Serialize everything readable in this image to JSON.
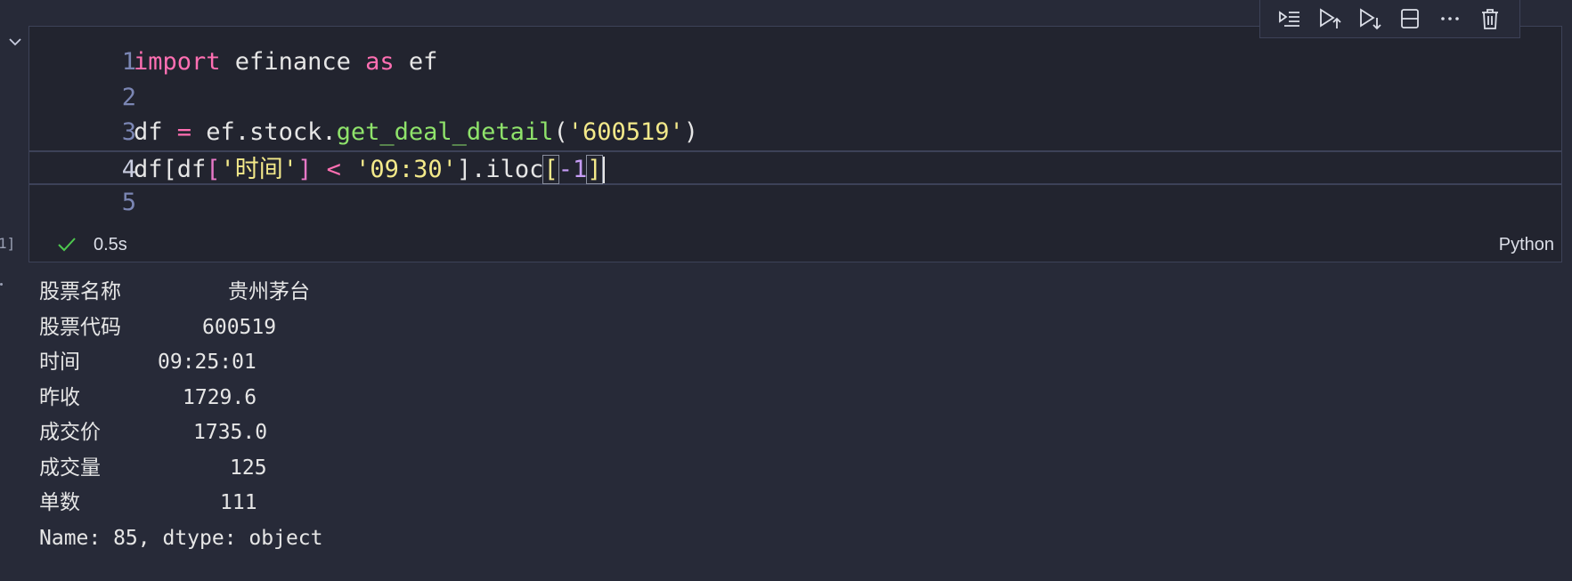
{
  "cell": {
    "execution_label": "1]",
    "code_lines": [
      {
        "num": "1"
      },
      {
        "num": "2"
      },
      {
        "num": "3"
      },
      {
        "num": "4"
      },
      {
        "num": "5"
      }
    ],
    "tokens": {
      "l1_import": "import",
      "l1_mod": " efinance ",
      "l1_as": "as",
      "l1_alias": " ef",
      "l3_df": "df ",
      "l3_eq": "=",
      "l3_obj": " ef.stock.",
      "l3_fn": "get_deal_detail",
      "l3_lp": "(",
      "l3_arg": "'600519'",
      "l3_rp": ")",
      "l4_a": "df[df",
      "l4_lb": "[",
      "l4_key": "'时间'",
      "l4_rb": "]",
      "l4_lt": " < ",
      "l4_val": "'09:30'",
      "l4_b": "].iloc",
      "l4_lb2": "[",
      "l4_neg": "-1",
      "l4_rb2": "]"
    },
    "status_time": "0.5s",
    "language": "Python"
  },
  "toolbar": {
    "icons": [
      "run-by-line-icon",
      "execute-above-icon",
      "execute-below-icon",
      "split-cell-icon",
      "more-icon",
      "delete-icon"
    ]
  },
  "output": {
    "rows": [
      {
        "key": "股票名称",
        "value": "贵州茅台"
      },
      {
        "key": "股票代码",
        "value": "600519"
      },
      {
        "key": "时间",
        "value": "09:25:01"
      },
      {
        "key": "昨收",
        "value": "1729.6"
      },
      {
        "key": "成交价",
        "value": "1735.0"
      },
      {
        "key": "成交量",
        "value": "125"
      },
      {
        "key": "单数",
        "value": "111"
      }
    ],
    "footer": "Name: 85, dtype: object"
  },
  "colors": {
    "background": "#272a38",
    "keyword": "#ff6fb2",
    "function": "#8fe36b",
    "string": "#f3e98a",
    "number": "#c79df7",
    "success": "#4ec94e"
  }
}
